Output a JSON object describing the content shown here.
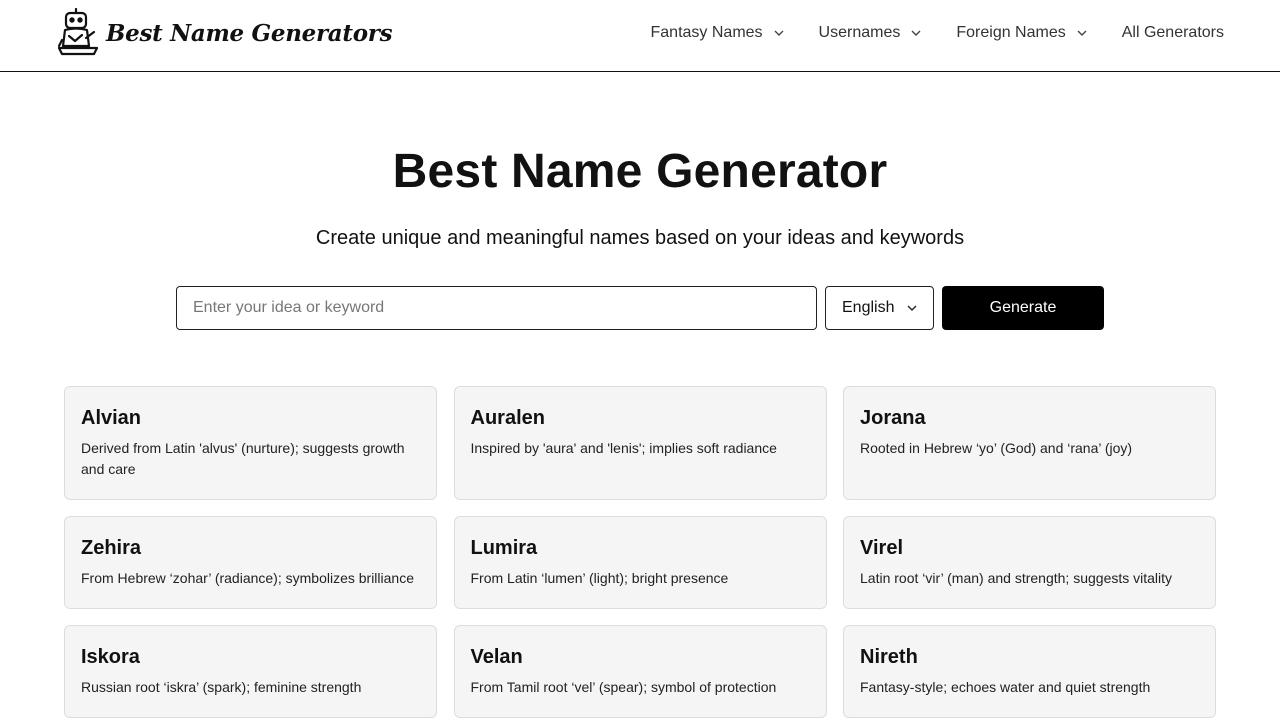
{
  "header": {
    "logo_text": "Best Name Generators",
    "nav": [
      {
        "label": "Fantasy Names",
        "has_dropdown": true
      },
      {
        "label": "Usernames",
        "has_dropdown": true
      },
      {
        "label": "Foreign Names",
        "has_dropdown": true
      },
      {
        "label": "All Generators",
        "has_dropdown": false
      }
    ]
  },
  "hero": {
    "title": "Best Name Generator",
    "subtitle": "Create unique and meaningful names based on your ideas and keywords"
  },
  "search": {
    "placeholder": "Enter your idea or keyword",
    "value": "",
    "language": "English",
    "button_label": "Generate"
  },
  "results": [
    {
      "name": "Alvian",
      "description": "Derived from Latin 'alvus' (nurture); suggests growth and care"
    },
    {
      "name": "Auralen",
      "description": "Inspired by 'aura' and 'lenis'; implies soft radiance"
    },
    {
      "name": "Jorana",
      "description": "Rooted in Hebrew ‘yo’ (God) and ‘rana’ (joy)"
    },
    {
      "name": "Zehira",
      "description": "From Hebrew ‘zohar’ (radiance); symbolizes brilliance"
    },
    {
      "name": "Lumira",
      "description": "From Latin ‘lumen’ (light); bright presence"
    },
    {
      "name": "Virel",
      "description": "Latin root ‘vir’ (man) and strength; suggests vitality"
    },
    {
      "name": "Iskora",
      "description": "Russian root ‘iskra’ (spark); feminine strength"
    },
    {
      "name": "Velan",
      "description": "From Tamil root ‘vel’ (spear); symbol of protection"
    },
    {
      "name": "Nireth",
      "description": "Fantasy-style; echoes water and quiet strength"
    }
  ],
  "icons": {
    "logo": "robot-mascot-icon",
    "dropdown": "chevron-down-icon"
  },
  "colors": {
    "primary_button": "#000000",
    "card_background": "#f5f5f5",
    "text": "#111111"
  }
}
